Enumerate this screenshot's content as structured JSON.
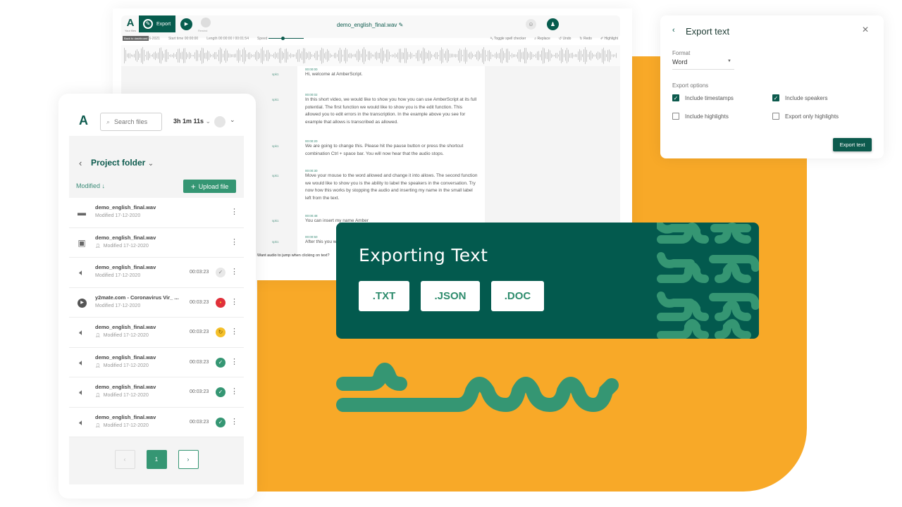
{
  "colors": {
    "brand_dark_green": "#035a4e",
    "brand_green": "#359673",
    "accent_orange": "#f8a928",
    "status_error": "#e0303a",
    "status_processing": "#f5c02a",
    "status_done": "#359673"
  },
  "editor": {
    "logo_sub": "Your files",
    "export_label": "Export",
    "rewind_label": "Rewind",
    "filename": "demo_english_final.wav",
    "back_tooltip": "Back to dashboard",
    "date_fragment": "6-2021",
    "start_time_label": "Start time",
    "start_time_value": "00:00:00",
    "length_label": "Length",
    "length_value": "00:00:00 / 00:01:54",
    "speed_label": "Speed",
    "tools": [
      "Toggle spell checker",
      "Replace",
      "Undo",
      "Redo",
      "Highlight"
    ],
    "jump_prompt": "Want audio to jump when clicking on text?",
    "segments": [
      {
        "speaker": "spk1",
        "time": "00:00:00",
        "text": "Hi, welcome at AmberScript."
      },
      {
        "speaker": "spk1",
        "time": "00:00:02",
        "text": "In this short video, we would like to show you how you can use AmberScript at its full potential. The first function we would like to show you is the edit function. This allowed you to edit errors in the transcription. In the example above you see for example that allows is transcribed as allowed."
      },
      {
        "speaker": "spk1",
        "time": "00:00:20",
        "text": "We are going to change this. Please hit the pause button or press the shortcut combination Ctrl + space bar. You will now hear that the audio stops."
      },
      {
        "speaker": "spk1",
        "time": "00:00:30",
        "text": "Move your mouse to the word allowed and change it into allows. The second function we would like to show you is the ability to label the speakers in the conversation. Try now how this works by stopping the audio and inserting my name in the small label left from the text."
      },
      {
        "speaker": "spk1",
        "time": "00:00:48",
        "text": "You can insert my name Amber"
      },
      {
        "speaker": "spk1",
        "time": "00:00:50",
        "text": "After this you w"
      }
    ]
  },
  "files": {
    "search_placeholder": "Search files",
    "time_left": "3h 1m 11s",
    "folder_title": "Project folder",
    "sort_label": "Modified",
    "upload_label": "Upload file",
    "rows": [
      {
        "icon": "folder",
        "name": "demo_english_final.wav",
        "modified": "Modified 17-12-2020",
        "shared": false,
        "duration": "",
        "status": ""
      },
      {
        "icon": "shared-folder",
        "name": "demo_english_final.wav",
        "modified": "Modified 17-12-2020",
        "shared": true,
        "duration": "",
        "status": ""
      },
      {
        "icon": "audio",
        "name": "demo_english_final.wav",
        "modified": "Modified 17-12-2020",
        "shared": false,
        "duration": "00:03:23",
        "status": "pending"
      },
      {
        "icon": "video",
        "name": "y2mate.com - Coronavirus Vir_ ...",
        "modified": "Modified 17-12-2020",
        "shared": false,
        "duration": "00:03:23",
        "status": "error"
      },
      {
        "icon": "audio",
        "name": "demo_english_final.wav",
        "modified": "Modified 17-12-2020",
        "shared": true,
        "duration": "00:03:23",
        "status": "processing"
      },
      {
        "icon": "audio",
        "name": "demo_english_final.wav",
        "modified": "Modified 17-12-2020",
        "shared": true,
        "duration": "00:03:23",
        "status": "done"
      },
      {
        "icon": "audio",
        "name": "demo_english_final.wav",
        "modified": "Modified 17-12-2020",
        "shared": true,
        "duration": "00:03:23",
        "status": "done"
      },
      {
        "icon": "audio",
        "name": "demo_english_final.wav",
        "modified": "Modified 17-12-2020",
        "shared": true,
        "duration": "00:03:23",
        "status": "done"
      }
    ],
    "pager": {
      "current": "1"
    }
  },
  "dialog": {
    "title": "Export text",
    "format_label": "Format",
    "format_value": "Word",
    "options_label": "Export options",
    "options": [
      {
        "label": "Include timestamps",
        "checked": true
      },
      {
        "label": "Include speakers",
        "checked": true
      },
      {
        "label": "Include highlights",
        "checked": false
      },
      {
        "label": "Export only highlights",
        "checked": false
      }
    ],
    "submit_label": "Export text"
  },
  "banner": {
    "title": "Exporting Text",
    "formats": [
      ".TXT",
      ".JSON",
      ".DOC"
    ]
  }
}
